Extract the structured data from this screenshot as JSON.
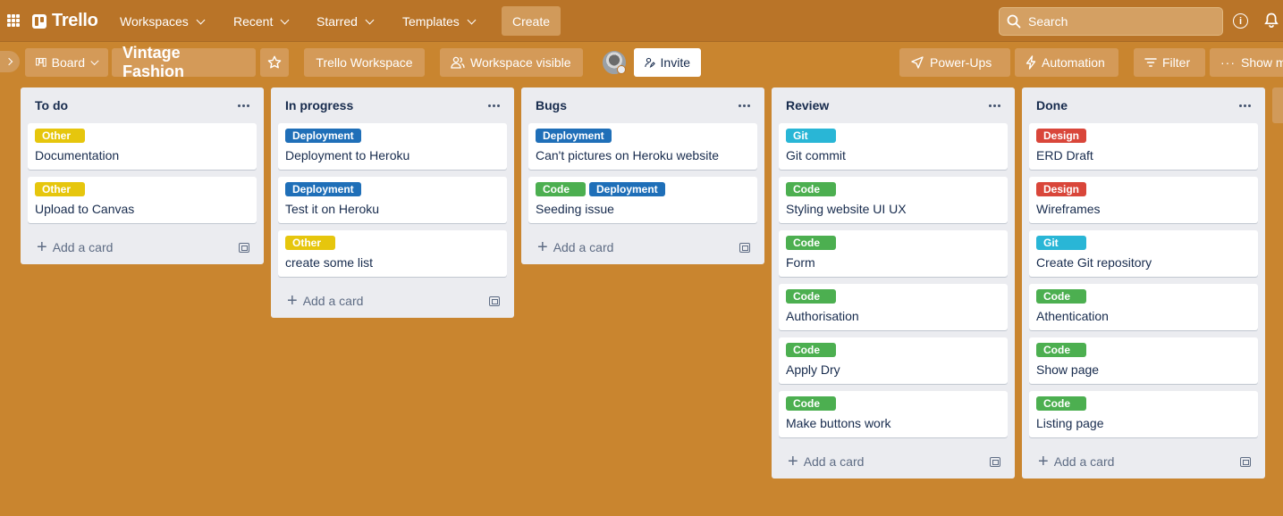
{
  "nav": {
    "logo": "Trello",
    "workspaces": "Workspaces",
    "recent": "Recent",
    "starred": "Starred",
    "templates": "Templates",
    "create": "Create",
    "search_placeholder": "Search"
  },
  "board": {
    "view": "Board",
    "title": "Vintage Fashion",
    "workspace": "Trello Workspace",
    "visibility": "Workspace visible",
    "invite": "Invite",
    "powerups": "Power-Ups",
    "automation": "Automation",
    "filter": "Filter",
    "show_menu": "Show m"
  },
  "add_card_label": "Add a card",
  "label_colors": {
    "Other": "#e6c60d",
    "Deployment": "#1f6fb8",
    "Code": "#4caf50",
    "Git": "#29b6d6",
    "Design": "#d9463a"
  },
  "lists": [
    {
      "title": "To do",
      "cards": [
        {
          "labels": [
            "Other"
          ],
          "title": "Documentation"
        },
        {
          "labels": [
            "Other"
          ],
          "title": "Upload to Canvas"
        }
      ]
    },
    {
      "title": "In progress",
      "cards": [
        {
          "labels": [
            "Deployment"
          ],
          "title": "Deployment to Heroku"
        },
        {
          "labels": [
            "Deployment"
          ],
          "title": "Test it on Heroku"
        },
        {
          "labels": [
            "Other"
          ],
          "title": "create some list"
        }
      ]
    },
    {
      "title": "Bugs",
      "cards": [
        {
          "labels": [
            "Deployment"
          ],
          "title": "Can't pictures on Heroku website"
        },
        {
          "labels": [
            "Code",
            "Deployment"
          ],
          "title": "Seeding issue"
        }
      ]
    },
    {
      "title": "Review",
      "cards": [
        {
          "labels": [
            "Git"
          ],
          "title": "Git commit"
        },
        {
          "labels": [
            "Code"
          ],
          "title": "Styling website UI UX"
        },
        {
          "labels": [
            "Code"
          ],
          "title": "Form"
        },
        {
          "labels": [
            "Code"
          ],
          "title": "Authorisation"
        },
        {
          "labels": [
            "Code"
          ],
          "title": "Apply Dry"
        },
        {
          "labels": [
            "Code"
          ],
          "title": "Make buttons work"
        }
      ]
    },
    {
      "title": "Done",
      "cards": [
        {
          "labels": [
            "Design"
          ],
          "title": "ERD Draft"
        },
        {
          "labels": [
            "Design"
          ],
          "title": "Wireframes"
        },
        {
          "labels": [
            "Git"
          ],
          "title": "Create Git repository"
        },
        {
          "labels": [
            "Code"
          ],
          "title": "Athentication"
        },
        {
          "labels": [
            "Code"
          ],
          "title": "Show page"
        },
        {
          "labels": [
            "Code"
          ],
          "title": "Listing page"
        }
      ]
    }
  ]
}
